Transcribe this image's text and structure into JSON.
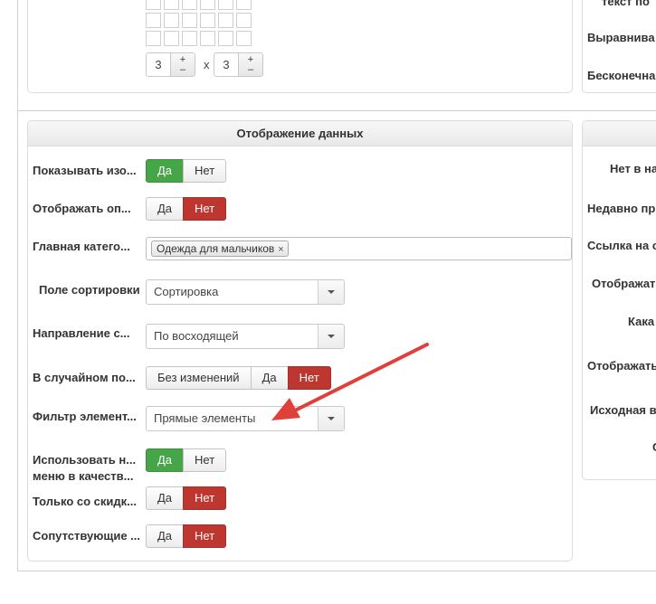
{
  "top_panel": {
    "rows_value": "3",
    "cols_value": "3",
    "times": "x",
    "plus": "+",
    "minus": "–",
    "right_labels": [
      "текст по",
      "Выравнива",
      "Бесконечна"
    ]
  },
  "display_panel": {
    "title": "Отображение данных",
    "rows": [
      {
        "label": "Показывать изо...",
        "options": [
          "Да",
          "Нет"
        ],
        "active": "Да"
      },
      {
        "label": "Отображать оп...",
        "options": [
          "Да",
          "Нет"
        ],
        "active": "Нет"
      },
      {
        "label": "Главная катего...",
        "tag": "Одежда для мальчиков",
        "tag_remove": "×"
      },
      {
        "label": "Поле сортировки",
        "select": "Сортировка"
      },
      {
        "label": "Направление с...",
        "select": "По восходящей"
      },
      {
        "label": "В случайном по...",
        "options": [
          "Без изменений",
          "Да",
          "Нет"
        ],
        "active": "Нет"
      },
      {
        "label": "Фильтр элемент...",
        "select": "Прямые элементы"
      },
      {
        "label_line1": "Использовать н...",
        "label_line2": "меню в качеств...",
        "options": [
          "Да",
          "Нет"
        ],
        "active": "Да"
      },
      {
        "label": "Только со скидк...",
        "options": [
          "Да",
          "Нет"
        ],
        "active": "Нет"
      },
      {
        "label": "Сопутствующие ...",
        "options": [
          "Да",
          "Нет"
        ],
        "active": "Нет"
      }
    ]
  },
  "right_panel": {
    "labels": [
      "Нет в на",
      "Недавно пр",
      "Ссылка на с",
      "Отображат",
      "Кака",
      "Отображать",
      "Исходная в",
      "С"
    ]
  },
  "colors": {
    "active_yes": "#46a546",
    "active_no": "#bd362f",
    "annotation_arrow": "#e0403a"
  }
}
